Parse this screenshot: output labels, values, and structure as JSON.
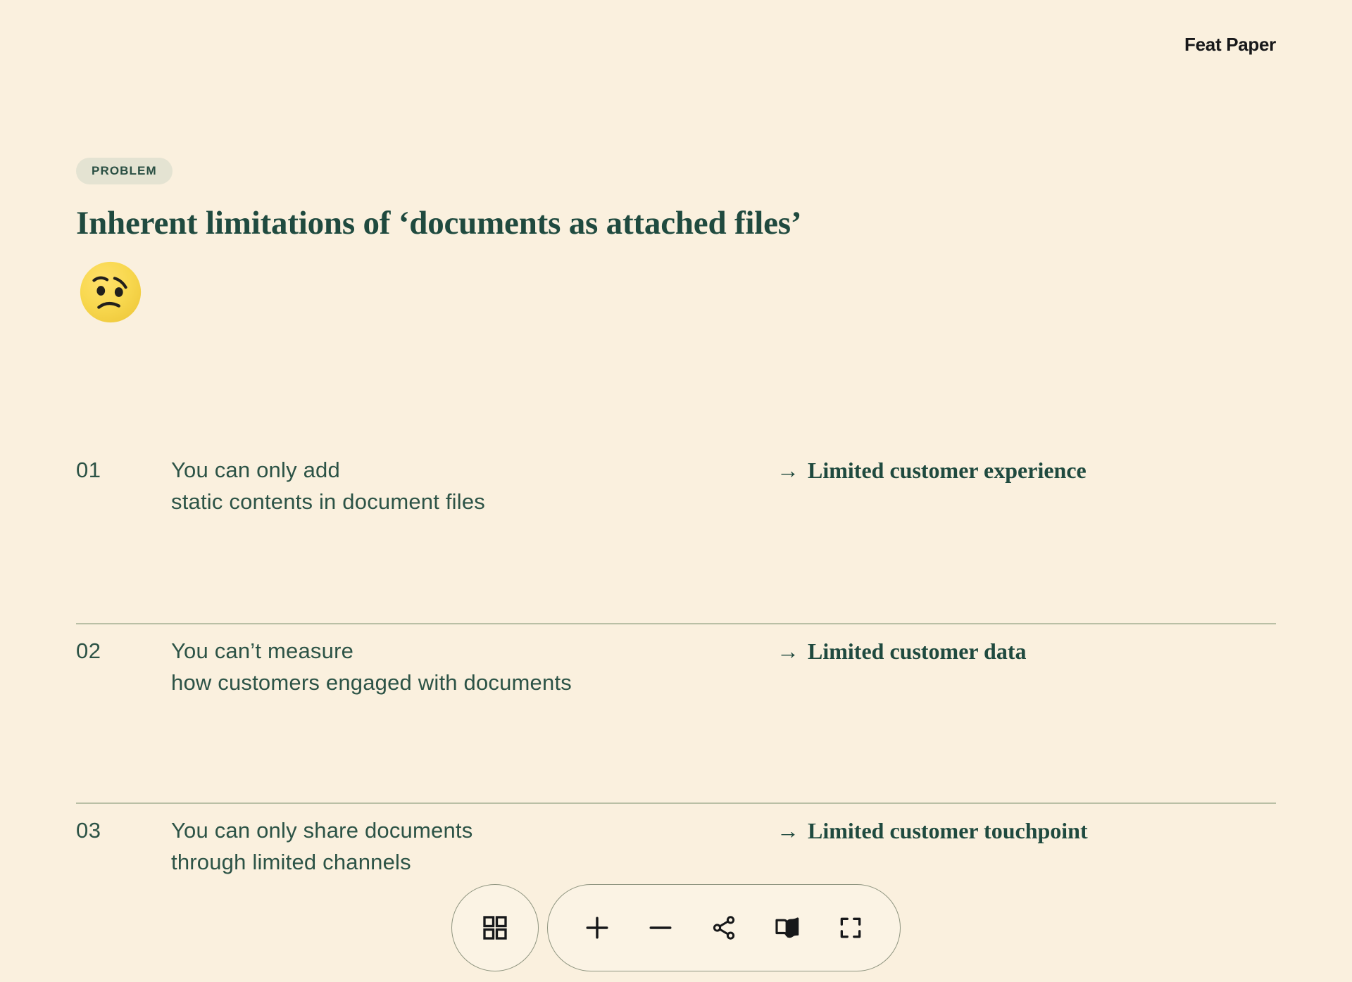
{
  "brand": {
    "name": "Feat Paper"
  },
  "header": {
    "badge": "PROBLEM",
    "title": "Inherent limitations of ‘documents as attached files’",
    "emoji_name": "worried-face-emoji",
    "colors": {
      "background": "#faf0de",
      "badge_background": "#e4e3d2",
      "heading": "#1f4a3f",
      "body_text": "#2c5346",
      "divider": "#b9bfa5",
      "brand_text": "#17181a"
    }
  },
  "rows": [
    {
      "number": "01",
      "line1": "You can only add",
      "line2": "static contents in document files",
      "arrow": "→",
      "result": "Limited customer experience"
    },
    {
      "number": "02",
      "line1": "You can’t measure",
      "line2": "how customers engaged with documents",
      "arrow": "→",
      "result": "Limited customer data"
    },
    {
      "number": "03",
      "line1": "You can only share documents",
      "line2": "through limited channels",
      "arrow": "→",
      "result": "Limited customer touchpoint"
    }
  ],
  "toolbar": {
    "grid_label": "grid-view",
    "zoom_in_label": "zoom-in",
    "zoom_out_label": "zoom-out",
    "share_label": "share",
    "reading_label": "reading-mode",
    "fullscreen_label": "fullscreen"
  }
}
